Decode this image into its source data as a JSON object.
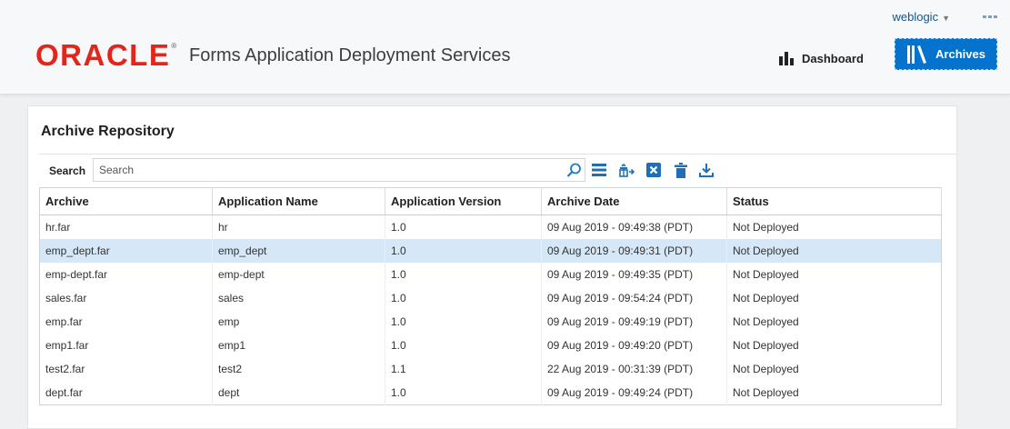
{
  "header": {
    "logo": "ORACLE",
    "logo_mark": "®",
    "title": "Forms Application Deployment Services",
    "user": "weblogic",
    "nav": {
      "dashboard": "Dashboard",
      "archives": "Archives"
    },
    "icons": {
      "dashboard": "bar-chart-icon",
      "archives": "books-icon",
      "more": "more-menu-icon",
      "user_caret": "caret-down-icon"
    }
  },
  "panel": {
    "title": "Archive Repository",
    "search": {
      "label": "Search",
      "placeholder": "Search",
      "value": ""
    },
    "toolbar": [
      "search-icon",
      "list-icon",
      "deploy-icon",
      "undeploy-icon",
      "delete-icon",
      "download-icon"
    ],
    "columns": [
      "Archive",
      "Application Name",
      "Application Version",
      "Archive Date",
      "Status"
    ],
    "rows": [
      [
        "hr.far",
        "hr",
        "1.0",
        "09 Aug 2019 - 09:49:38 (PDT)",
        "Not Deployed"
      ],
      [
        "emp_dept.far",
        "emp_dept",
        "1.0",
        "09 Aug 2019 - 09:49:31 (PDT)",
        "Not Deployed"
      ],
      [
        "emp-dept.far",
        "emp-dept",
        "1.0",
        "09 Aug 2019 - 09:49:35 (PDT)",
        "Not Deployed"
      ],
      [
        "sales.far",
        "sales",
        "1.0",
        "09 Aug 2019 - 09:54:24 (PDT)",
        "Not Deployed"
      ],
      [
        "emp.far",
        "emp",
        "1.0",
        "09 Aug 2019 - 09:49:19 (PDT)",
        "Not Deployed"
      ],
      [
        "emp1.far",
        "emp1",
        "1.0",
        "09 Aug 2019 - 09:49:20 (PDT)",
        "Not Deployed"
      ],
      [
        "test2.far",
        "test2",
        "1.1",
        "22 Aug 2019 - 00:31:39 (PDT)",
        "Not Deployed"
      ],
      [
        "dept.far",
        "dept",
        "1.0",
        "09 Aug 2019 - 09:49:24 (PDT)",
        "Not Deployed"
      ]
    ],
    "selected_row": 1
  },
  "colors": {
    "brand_red": "#e3261c",
    "accent_blue": "#0572ce",
    "selection": "#d6e7f7",
    "link": "#14548f"
  }
}
